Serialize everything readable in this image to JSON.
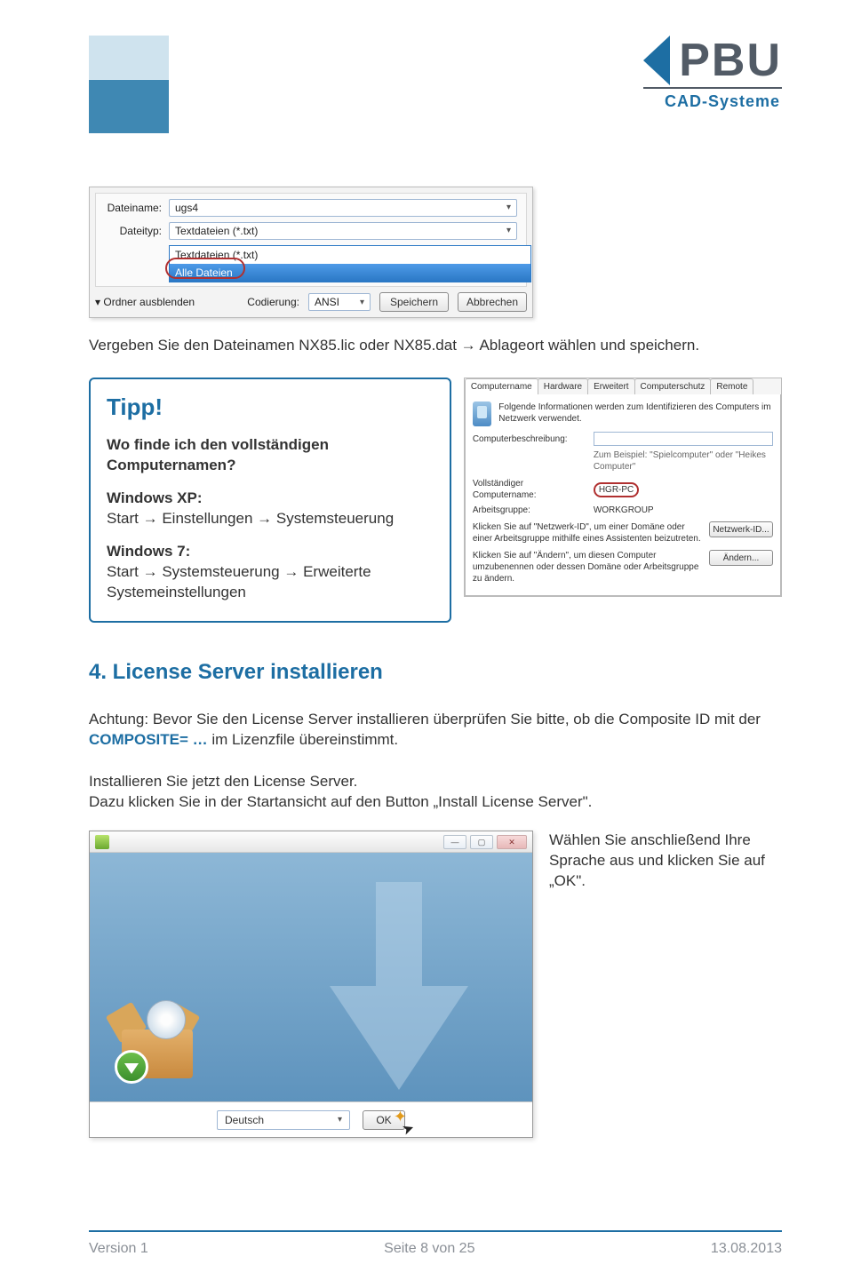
{
  "logo": {
    "text": "PBU",
    "subtitle": "CAD-Systeme"
  },
  "saveDialog": {
    "filenameLabel": "Dateiname:",
    "filenameValue": "ugs4",
    "filetypeLabel": "Dateityp:",
    "filetypeValue": "Textdateien (*.txt)",
    "options": {
      "opt1": "Textdateien (*.txt)",
      "opt2": "Alle Dateien"
    },
    "hideFolders": "Ordner ausblenden",
    "encodingLabel": "Codierung:",
    "encodingValue": "ANSI",
    "saveBtn": "Speichern",
    "cancelBtn": "Abbrechen"
  },
  "paragraph1": "Vergeben Sie den Dateinamen NX85.lic oder NX85.dat → Ablageort wählen und speichern.",
  "tip": {
    "title": "Tipp!",
    "question": "Wo finde ich den vollständigen Computernamen?",
    "xpHead": "Windows XP:",
    "xpPath": "Start → Einstellungen → Systemsteuerung",
    "w7Head": "Windows 7:",
    "w7Path": "Start → Systemsteuerung → Erweiterte Systemeinstellungen"
  },
  "sysProps": {
    "tabs": {
      "t1": "Computername",
      "t2": "Hardware",
      "t3": "Erweitert",
      "t4": "Computerschutz",
      "t5": "Remote"
    },
    "intro": "Folgende Informationen werden zum Identifizieren des Computers im Netzwerk verwendet.",
    "descLabel": "Computerbeschreibung:",
    "descHint": "Zum Beispiel: \"Spielcomputer\" oder \"Heikes Computer\"",
    "fullNameLabel": "Vollständiger Computername:",
    "fullNameValue": "HGR-PC",
    "workgroupLabel": "Arbeitsgruppe:",
    "workgroupValue": "WORKGROUP",
    "networkIdText": "Klicken Sie auf \"Netzwerk-ID\", um einer Domäne oder einer Arbeitsgruppe mithilfe eines Assistenten beizutreten.",
    "networkIdBtn": "Netzwerk-ID...",
    "changeText": "Klicken Sie auf \"Ändern\", um diesen Computer umzubenennen oder dessen Domäne oder Arbeitsgruppe zu ändern.",
    "changeBtn": "Ändern..."
  },
  "section": {
    "heading": "4. License Server installieren",
    "warn1": "Achtung: Bevor Sie den License Server installieren überprüfen Sie bitte, ob die Composite ID mit der ",
    "composite": "COMPOSITE= …",
    "warn2": " im Lizenzfile übereinstimmt.",
    "p2a": "Installieren Sie jetzt den License Server.",
    "p2b": "Dazu klicken Sie in der Startansicht auf den Button „Install License Server\".",
    "p3": "Wählen Sie anschließend Ihre Sprache aus und klicken Sie auf „OK\"."
  },
  "installer": {
    "language": "Deutsch",
    "okBtn": "OK"
  },
  "footer": {
    "left": "Version 1",
    "center": "Seite 8 von 25",
    "right": "13.08.2013"
  }
}
